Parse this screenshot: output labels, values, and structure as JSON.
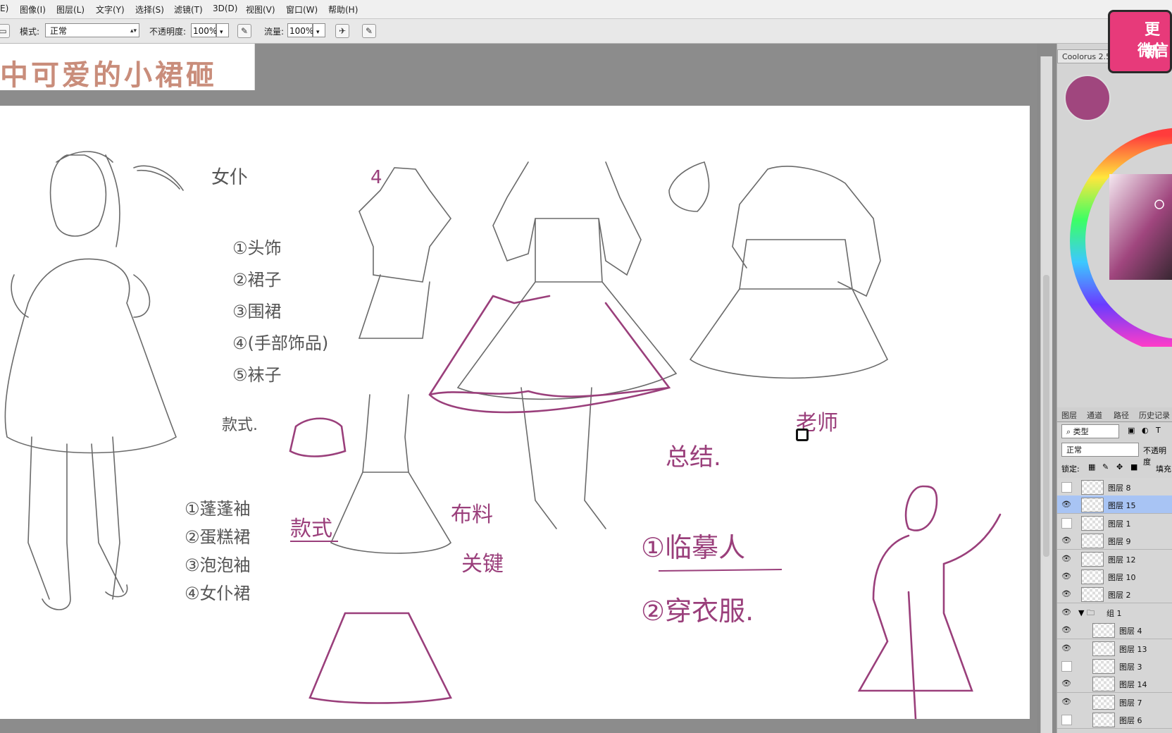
{
  "menu": [
    "E)",
    "图像(I)",
    "图层(L)",
    "文字(Y)",
    "选择(S)",
    "滤镜(T)",
    "3D(D)",
    "视图(V)",
    "窗口(W)",
    "帮助(H)"
  ],
  "options": {
    "mode_label": "模式:",
    "mode_value": "正常",
    "opacity_label": "不透明度:",
    "opacity_value": "100%",
    "flow_label": "流量:",
    "flow_value": "100%"
  },
  "title_banner": "中可爱的小裙砸",
  "badge": {
    "line1": "更新",
    "line2": "微信"
  },
  "colorus_tab": "Coolorus 2.5",
  "panel_tabs": [
    "图层",
    "通道",
    "路径",
    "历史记录"
  ],
  "layer_filter": "类型",
  "blend_mode": "正常",
  "opacity_label": "不透明度",
  "lock_label": "锁定:",
  "fill_label": "填充",
  "layers": [
    {
      "name": "图层 8",
      "visible": false,
      "indent": 0,
      "selected": false
    },
    {
      "name": "图层 15",
      "visible": true,
      "indent": 0,
      "selected": true
    },
    {
      "name": "图层 1",
      "visible": false,
      "indent": 0,
      "selected": false
    },
    {
      "name": "图层 9",
      "visible": true,
      "indent": 0,
      "selected": false
    },
    {
      "name": "图层 12",
      "visible": true,
      "indent": 0,
      "selected": false
    },
    {
      "name": "图层 10",
      "visible": true,
      "indent": 0,
      "selected": false
    },
    {
      "name": "图层 2",
      "visible": true,
      "indent": 0,
      "selected": false
    },
    {
      "name": "组 1",
      "visible": true,
      "indent": 0,
      "selected": false,
      "group": true
    },
    {
      "name": "图层 4",
      "visible": true,
      "indent": 1,
      "selected": false
    },
    {
      "name": "图层 13",
      "visible": true,
      "indent": 1,
      "selected": false
    },
    {
      "name": "图层 3",
      "visible": false,
      "indent": 1,
      "selected": false
    },
    {
      "name": "图层 14",
      "visible": true,
      "indent": 1,
      "selected": false
    },
    {
      "name": "图层 7",
      "visible": true,
      "indent": 1,
      "selected": false
    },
    {
      "name": "图层 6",
      "visible": false,
      "indent": 1,
      "selected": false
    }
  ],
  "sketch_notes": {
    "maid_title": "女仆",
    "items": [
      "①头饰",
      "②裙子",
      "③围裙",
      "④(手部饰品)",
      "⑤袜子"
    ],
    "style_label": "款式.",
    "sleeves": [
      "①蓬蓬袖",
      "②蛋糕裙",
      "③泡泡袖",
      "④女仆裙"
    ],
    "kuanshi2": "款式",
    "buliao": "布料",
    "guanjian": "关键",
    "zongjie": "总结.",
    "num4": "4",
    "laoshi": "老师",
    "summary": [
      "①临摹人",
      "②穿衣服."
    ]
  },
  "colors": {
    "foreground": "#a0467e",
    "ink_purple": "#9a3f7b",
    "pencil_gray": "#6a6a6a",
    "selected_layer": "#a8c4f4"
  }
}
